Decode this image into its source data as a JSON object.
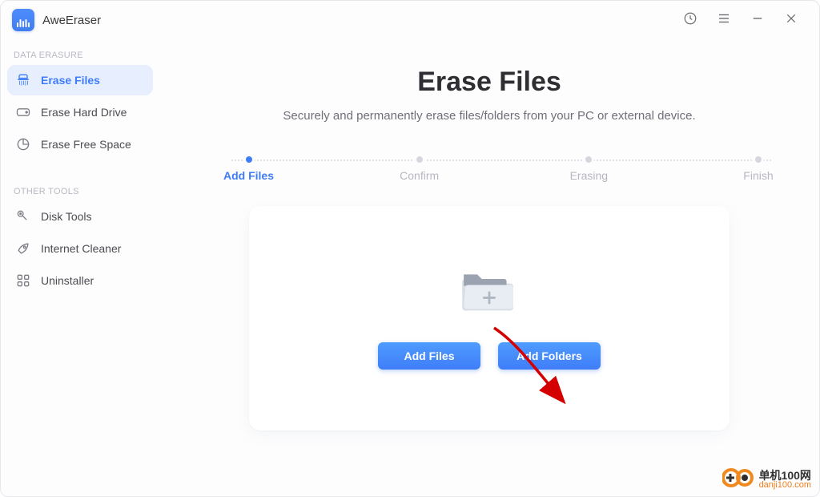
{
  "app": {
    "title": "AweEraser"
  },
  "titlebar": {
    "icons": {
      "history": "history",
      "menu": "menu",
      "minimize": "minimize",
      "close": "close"
    }
  },
  "sidebar": {
    "section1_label": "DATA ERASURE",
    "section2_label": "OTHER TOOLS",
    "items": [
      {
        "label": "Erase Files"
      },
      {
        "label": "Erase Hard Drive"
      },
      {
        "label": "Erase Free Space"
      },
      {
        "label": "Disk Tools"
      },
      {
        "label": "Internet Cleaner"
      },
      {
        "label": "Uninstaller"
      }
    ]
  },
  "main": {
    "title": "Erase Files",
    "subtitle": "Securely and permanently erase files/folders from your PC or external device.",
    "steps": [
      {
        "label": "Add Files",
        "active": true
      },
      {
        "label": "Confirm",
        "active": false
      },
      {
        "label": "Erasing",
        "active": false
      },
      {
        "label": "Finish",
        "active": false
      }
    ],
    "buttons": {
      "add_files": "Add Files",
      "add_folders": "Add Folders"
    }
  },
  "watermark": {
    "top": "单机100网",
    "bottom": "danji100.com"
  },
  "colors": {
    "accent": "#3f7df8"
  }
}
